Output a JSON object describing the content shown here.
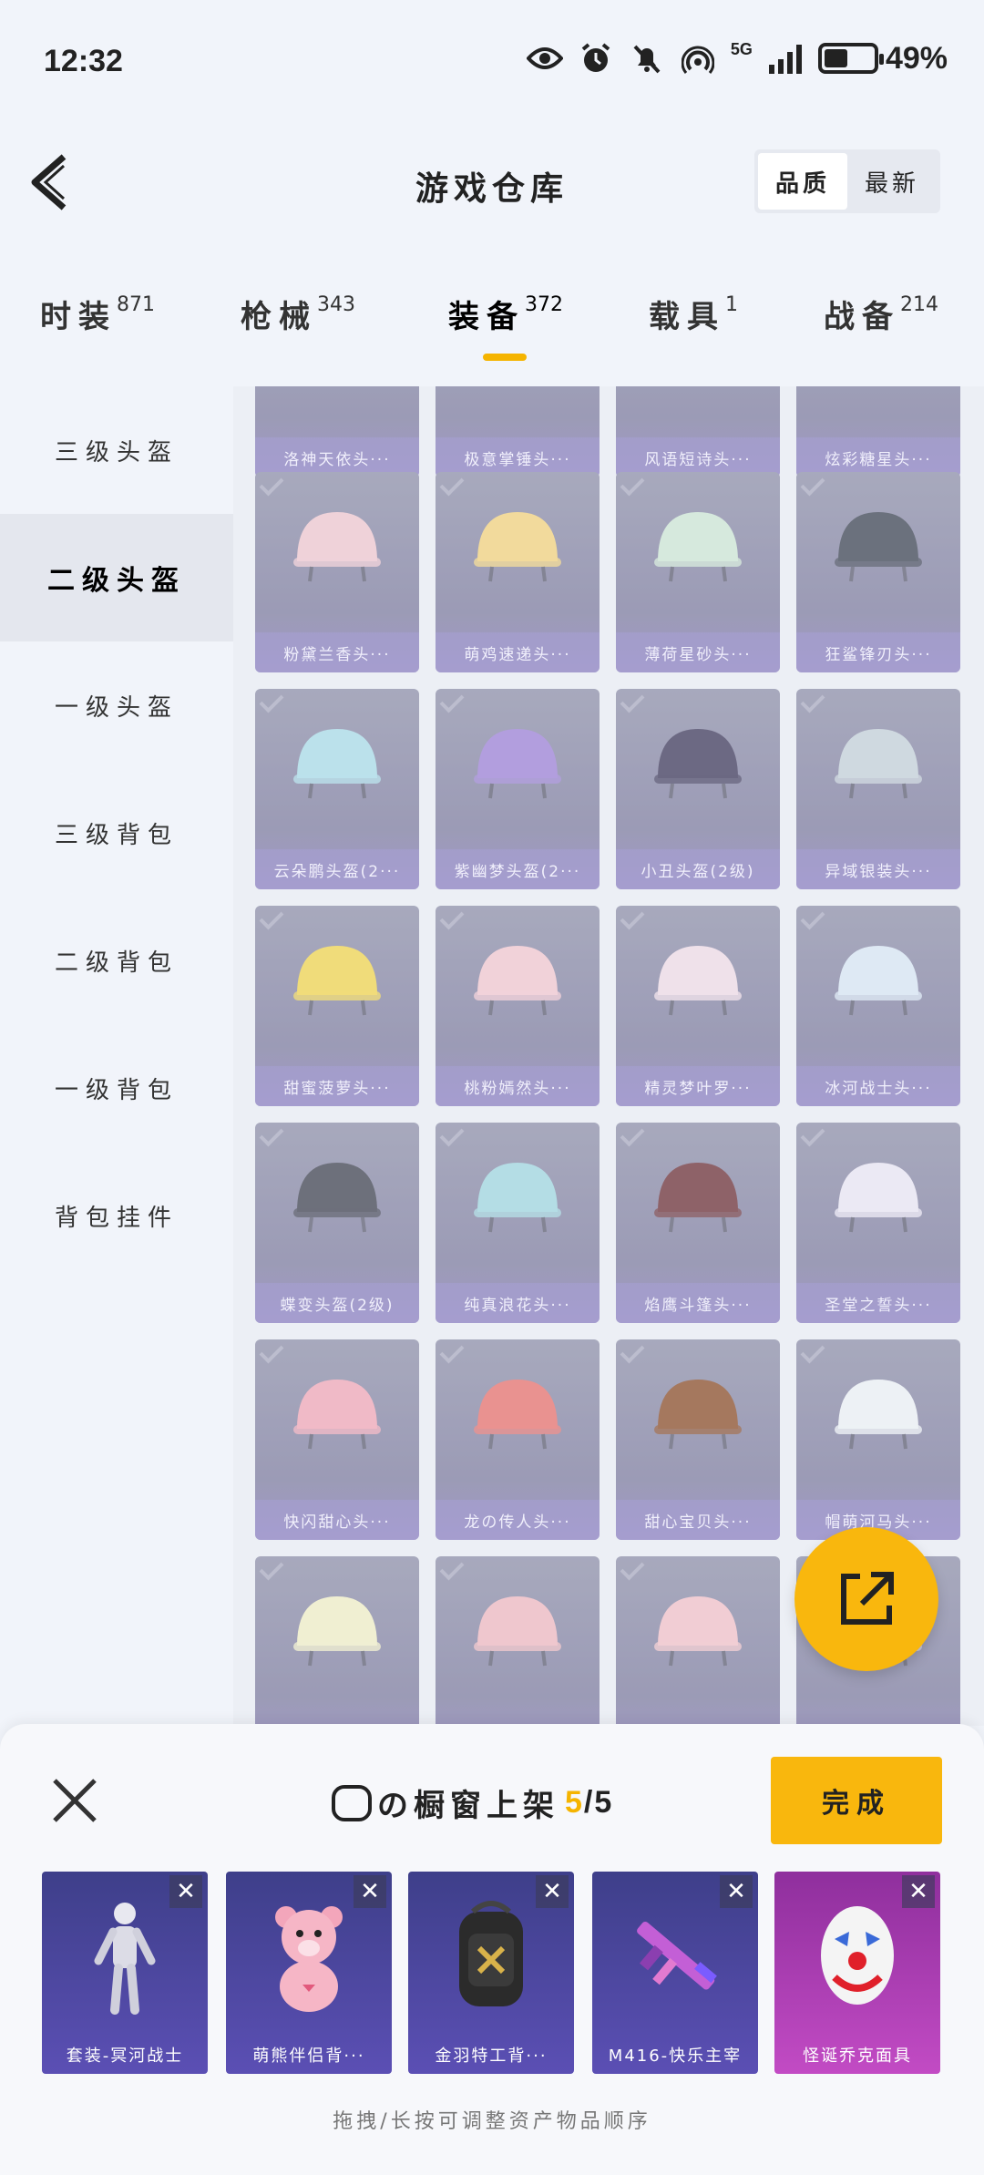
{
  "status_bar": {
    "time": "12:32",
    "network": "5G",
    "battery": "49%",
    "battery_level": 0.49
  },
  "header": {
    "title": "游戏仓库",
    "sort_options": [
      "品质",
      "最新"
    ],
    "sort_active": "品质"
  },
  "tabs": [
    {
      "label": "时装",
      "count": "871"
    },
    {
      "label": "枪械",
      "count": "343"
    },
    {
      "label": "装备",
      "count": "372",
      "active": true
    },
    {
      "label": "载具",
      "count": "1"
    },
    {
      "label": "战备",
      "count": "214"
    }
  ],
  "sidebar": {
    "items": [
      "三级头盔",
      "二级头盔",
      "一级头盔",
      "三级背包",
      "二级背包",
      "一级背包",
      "背包挂件"
    ],
    "active": "二级头盔"
  },
  "grid": {
    "top_row_labels": [
      "洛神天依头···",
      "极意掌锤头···",
      "风语短诗头···",
      "炫彩糖星头···"
    ],
    "items": [
      {
        "label": "粉黛兰香头···",
        "color": "#f0c7cf"
      },
      {
        "label": "萌鸡速递头···",
        "color": "#f4d27a"
      },
      {
        "label": "薄荷星砂头···",
        "color": "#cde6d5"
      },
      {
        "label": "狂鲨锋刃头···",
        "color": "#3a4050"
      },
      {
        "label": "云朵鹏头盔(2···",
        "color": "#a8dbe8"
      },
      {
        "label": "紫幽梦头盔(2···",
        "color": "#9b7fd6"
      },
      {
        "label": "小丑头盔(2级)",
        "color": "#3b3558"
      },
      {
        "label": "异域银装头···",
        "color": "#c4d0d8"
      },
      {
        "label": "甜蜜菠萝头···",
        "color": "#f2d54c"
      },
      {
        "label": "桃粉嫣然头···",
        "color": "#f3c6cf"
      },
      {
        "label": "精灵梦叶罗···",
        "color": "#f0dbe6"
      },
      {
        "label": "冰河战士头···",
        "color": "#d8e6f4"
      },
      {
        "label": "蝶变头盔(2级)",
        "color": "#3c3f4d"
      },
      {
        "label": "纯真浪花头···",
        "color": "#9fd6e0"
      },
      {
        "label": "焰鹰斗篷头···",
        "color": "#6a2c33"
      },
      {
        "label": "圣堂之誓头···",
        "color": "#ebe6f4"
      },
      {
        "label": "快闪甜心头···",
        "color": "#f2a6b6"
      },
      {
        "label": "龙の传人头···",
        "color": "#e86e6a"
      },
      {
        "label": "甜心宝贝头···",
        "color": "#8a4a25"
      },
      {
        "label": "帽萌河马头···",
        "color": "#eef2f6"
      },
      {
        "label": "",
        "color": "#f1efc5"
      },
      {
        "label": "",
        "color": "#f0b8bf"
      },
      {
        "label": "",
        "color": "#f3c0c8"
      },
      {
        "label": "",
        "color": "#c9c6dc"
      }
    ]
  },
  "sheet": {
    "title": "の橱窗上架",
    "count_current": "5",
    "count_total": "/5",
    "done_label": "完成",
    "showcase": [
      {
        "label": "套装-冥河战士"
      },
      {
        "label": "萌熊伴侣背···"
      },
      {
        "label": "金羽特工背···"
      },
      {
        "label": "M416-快乐主宰"
      },
      {
        "label": "怪诞乔克面具"
      }
    ],
    "close_glyph": "✕",
    "hint": "拖拽/长按可调整资产物品顺序"
  }
}
